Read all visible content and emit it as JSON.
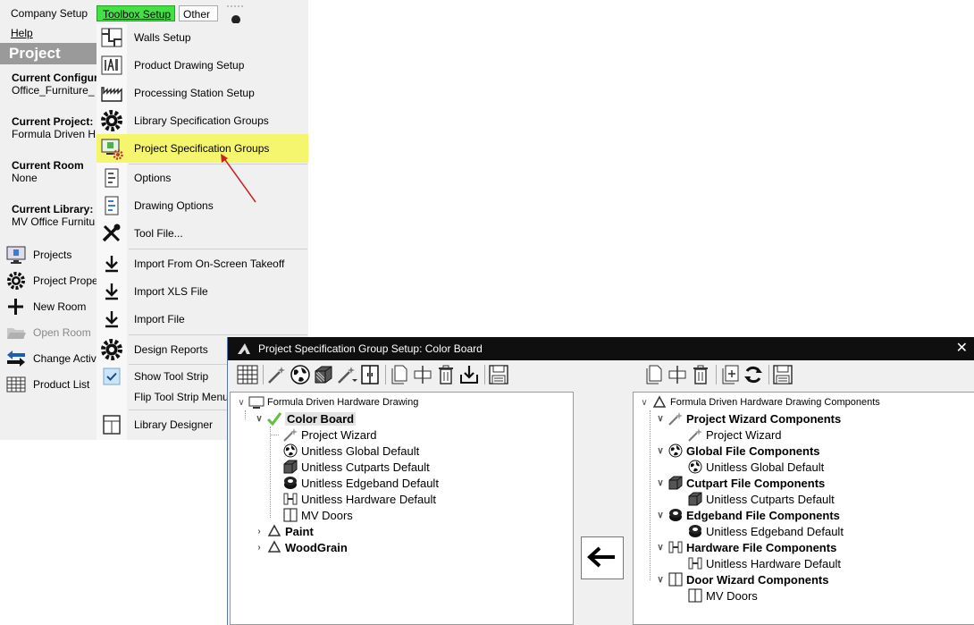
{
  "menubar": {
    "company_setup": "Company Setup",
    "toolbox_setup": "Toolbox Setup",
    "other": "Other",
    "help": "Help"
  },
  "left_panel": {
    "header": "Project",
    "current_configuration_label": "Current Configur",
    "current_configuration_value": "Office_Furniture_",
    "current_project_label": "Current Project:",
    "current_project_value": "Formula Driven H",
    "current_room_label": "Current Room",
    "current_room_value": "None",
    "current_library_label": "Current Library:",
    "current_library_value": "MV Office Furnitu",
    "buttons": [
      "Projects",
      "Project Prope",
      "New Room",
      "Open Room",
      "Change Activ",
      "Product List"
    ]
  },
  "dropdown": {
    "items": [
      "Walls Setup",
      "Product Drawing Setup",
      "Processing Station Setup",
      "Library Specification Groups",
      "Project Specification Groups",
      "Options",
      "Drawing Options",
      "Tool File...",
      "Import From On-Screen Takeoff",
      "Import XLS File",
      "Import File",
      "Design Reports",
      "Show Tool Strip",
      "Flip Tool Strip Menu",
      "Library Designer"
    ],
    "highlighted_index": 4
  },
  "dialog": {
    "title": "Project Specification Group Setup: Color Board",
    "close": "✕",
    "left_tree": {
      "root": "Formula Driven Hardware Drawing",
      "group": "Color Board",
      "children": [
        "Project Wizard",
        "Unitless Global Default",
        "Unitless Cutparts Default",
        "Unitless Edgeband Default",
        "Unitless Hardware Default",
        "MV Doors"
      ],
      "collapsed": [
        "Paint",
        "WoodGrain"
      ]
    },
    "right_tree": {
      "root": "Formula Driven Hardware Drawing Components",
      "groups": [
        {
          "name": "Project Wizard Components",
          "child": "Project Wizard"
        },
        {
          "name": "Global File Components",
          "child": "Unitless Global Default"
        },
        {
          "name": "Cutpart File Components",
          "child": "Unitless Cutparts Default"
        },
        {
          "name": "Edgeband File Components",
          "child": "Unitless Edgeband Default"
        },
        {
          "name": "Hardware File Components",
          "child": "Unitless Hardware Default"
        },
        {
          "name": "Door Wizard Components",
          "child": "MV Doors"
        }
      ]
    }
  },
  "colors": {
    "toolbox_tab": "#44e144",
    "highlight": "#f5f56e",
    "title_bar": "#0f0f0f",
    "arrow": "#cc2222"
  }
}
